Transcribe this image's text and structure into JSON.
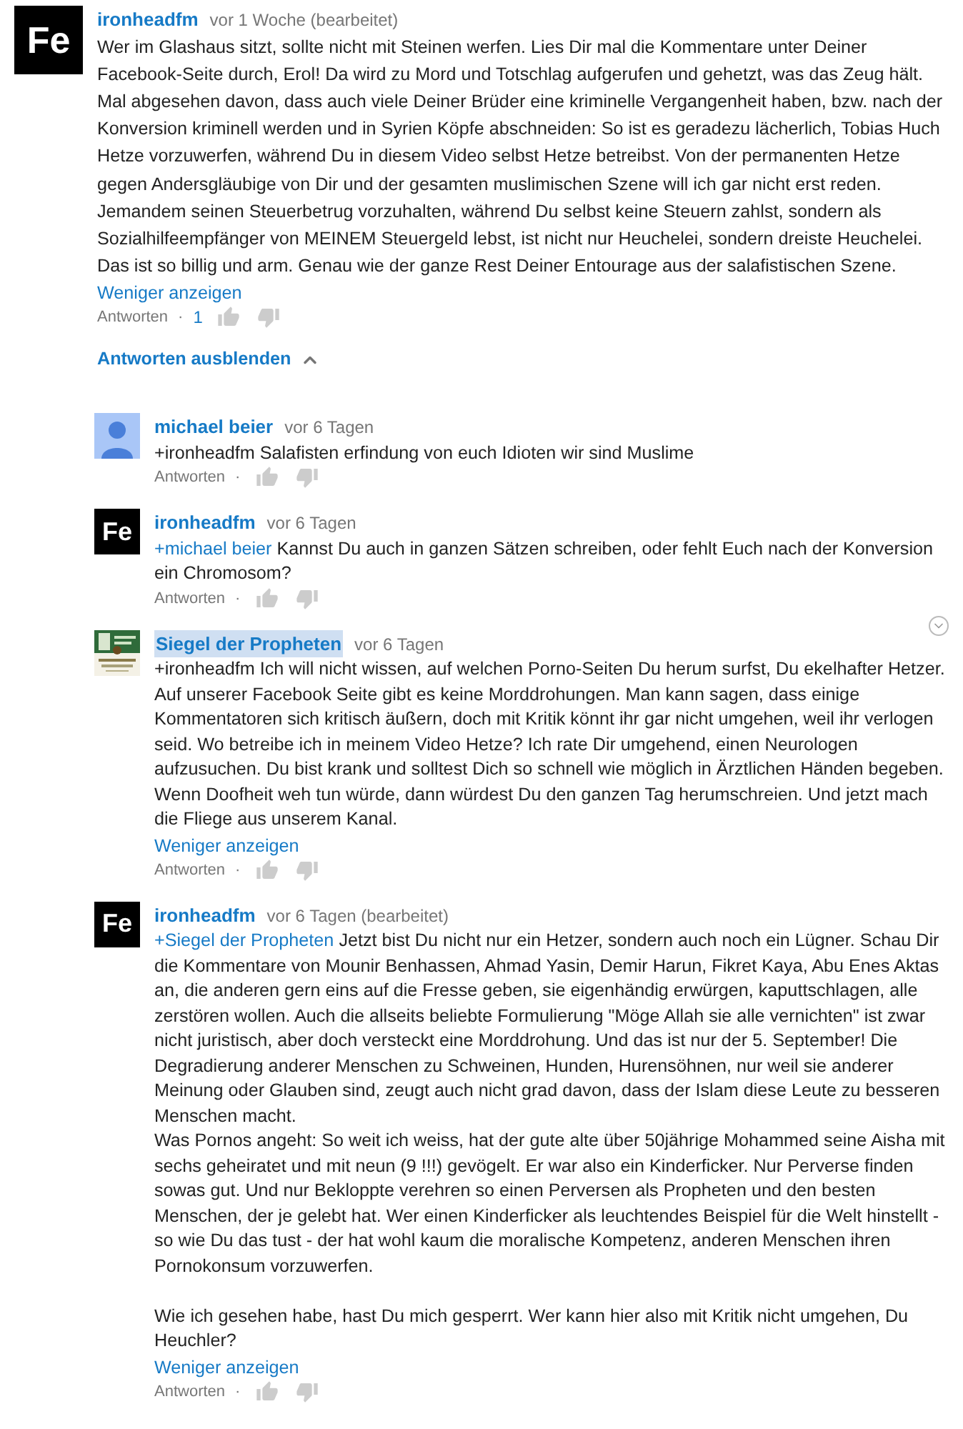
{
  "comment": {
    "author": "ironheadfm",
    "author_highlighted": false,
    "avatar": {
      "kind": "logo",
      "text": "Fe"
    },
    "time": "vor 1 Woche (bearbeitet)",
    "text": "Wer im Glashaus sitzt, sollte nicht mit Steinen werfen. Lies Dir mal die Kommentare unter Deiner Facebook-Seite durch, Erol! Da wird zu Mord und Totschlag aufgerufen und gehetzt, was das Zeug hält. Mal abgesehen davon, dass auch viele Deiner Brüder eine kriminelle Vergangenheit haben, bzw. nach der Konversion kriminell werden und in Syrien Köpfe abschneiden: So ist es geradezu lächerlich, Tobias Huch Hetze vorzuwerfen, während Du in diesem Video selbst Hetze betreibst. Von der permanenten Hetze gegen Andersgläubige von Dir und der gesamten muslimischen Szene will ich gar nicht erst reden. Jemandem seinen Steuerbetrug vorzuhalten, während Du selbst keine Steuern zahlst, sondern als Sozialhilfeempfänger von MEINEM Steuergeld lebst, ist nicht nur Heuchelei, sondern dreiste Heuchelei. Das ist so billig und arm. Genau wie der ganze Rest Deiner Entourage aus der salafistischen Szene.",
    "show_less": "Weniger anzeigen",
    "reply_label": "Antworten",
    "separator": "·",
    "likes": "1"
  },
  "toggle_replies": "Antworten ausblenden",
  "replies": [
    {
      "author": "michael beier",
      "author_highlighted": false,
      "avatar": {
        "kind": "silhouette"
      },
      "time": "vor 6 Tagen",
      "text": "+ironheadfm Salafisten erfindung von euch Idioten wir sind Muslime",
      "reply_label": "Antworten",
      "separator": "·"
    },
    {
      "author": "ironheadfm",
      "author_highlighted": false,
      "avatar": {
        "kind": "logo",
        "text": "Fe"
      },
      "time": "vor 6 Tagen",
      "mention": "+michael beier",
      "text": "Kannst Du auch in ganzen Sätzen schreiben, oder fehlt Euch nach der Konversion ein Chromosom?",
      "reply_label": "Antworten",
      "separator": "·"
    },
    {
      "author": "Siegel der Propheten",
      "author_highlighted": true,
      "time": "vor 6 Tagen",
      "text": "+ironheadfm Ich will nicht wissen, auf welchen Porno-Seiten Du herum surfst, Du ekelhafter Hetzer. Auf unserer Facebook Seite gibt es keine Morddrohungen. Man kann sagen, dass einige Kommentatoren sich kritisch äußern, doch mit Kritik könnt ihr gar nicht umgehen, weil ihr verlogen seid. Wo betreibe ich in meinem Video Hetze? Ich rate Dir umgehend, einen Neurologen aufzusuchen. Du bist krank und solltest Dich  so schnell wie möglich in Ärztlichen Händen begeben. Wenn Doofheit weh tun würde, dann würdest Du den ganzen Tag herumschreien. Und jetzt mach die Fliege aus unserem Kanal.",
      "show_less": "Weniger anzeigen",
      "reply_label": "Antworten",
      "separator": "·",
      "menu_icon": true
    },
    {
      "author": "ironheadfm",
      "author_highlighted": false,
      "avatar": {
        "kind": "logo",
        "text": "Fe"
      },
      "time": "vor 6 Tagen (bearbeitet)",
      "mention": "+Siegel der Propheten",
      "text": "Jetzt bist Du nicht nur ein Hetzer, sondern auch noch ein Lügner. Schau Dir die Kommentare von Mounir Benhassen, Ahmad Yasin, Demir Harun, Fikret Kaya, Abu Enes Aktas an, die anderen gern eins auf die Fresse geben, sie eigenhändig erwürgen, kaputtschlagen, alle zerstören wollen. Auch die allseits beliebte Formulierung \"Möge Allah sie alle vernichten\" ist zwar nicht juristisch, aber doch versteckt eine Morddrohung. Und das ist nur der 5. September! Die Degradierung anderer Menschen zu Schweinen, Hunden, Hurensöhnen, nur weil sie anderer Meinung oder Glauben sind, zeugt auch nicht grad davon, dass der Islam diese Leute zu besseren Menschen macht.\nWas Pornos angeht: So weit ich weiss, hat der gute alte über 50jährige Mohammed seine Aisha mit sechs geheiratet und mit neun (9 !!!) gevögelt. Er war also ein Kinderficker. Nur Perverse finden sowas gut. Und nur Bekloppte verehren so einen Perversen als Propheten und den besten Menschen, der je gelebt hat. Wer einen Kinderficker als leuchtendes Beispiel für die Welt hinstellt - so wie Du das tust - der hat wohl kaum die moralische Kompetenz, anderen Menschen ihren Pornokonsum vorzuwerfen.\n\nWie ich gesehen habe, hast Du mich gesperrt. Wer kann hier also mit Kritik nicht umgehen, Du Heuchler?",
      "show_less": "Weniger anzeigen",
      "reply_label": "Antworten",
      "separator": "·"
    }
  ]
}
